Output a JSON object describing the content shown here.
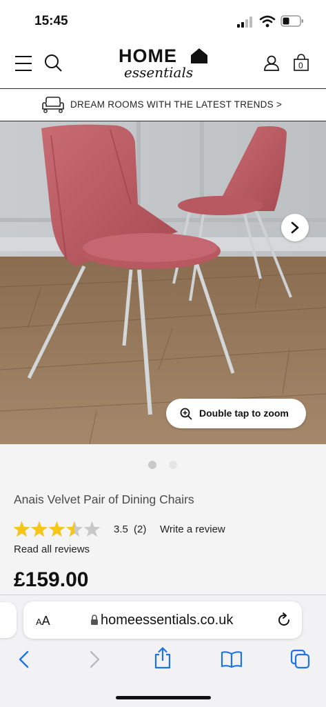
{
  "status_bar": {
    "time": "15:45"
  },
  "header": {
    "logo_line1": "HOME",
    "logo_line2": "essentials",
    "basket_count": "0"
  },
  "banner": {
    "text": "DREAM ROOMS WITH THE LATEST TRENDS  >"
  },
  "gallery": {
    "zoom_hint": "Double tap to zoom",
    "slide_count": 2,
    "active_slide": 1
  },
  "product": {
    "title": "Anais Velvet Pair of Dining Chairs",
    "rating": "3.5",
    "review_count": "(2)",
    "write_review": "Write a review",
    "read_all": "Read all reviews",
    "price": "£159.00",
    "stars_value": 3.5,
    "stars_max": 5
  },
  "safari": {
    "text_size": "AA",
    "url": "homeessentials.co.uk"
  },
  "colors": {
    "star": "#f5c518",
    "star_empty": "#c8c8c8",
    "accent_blue": "#1a74e8"
  }
}
